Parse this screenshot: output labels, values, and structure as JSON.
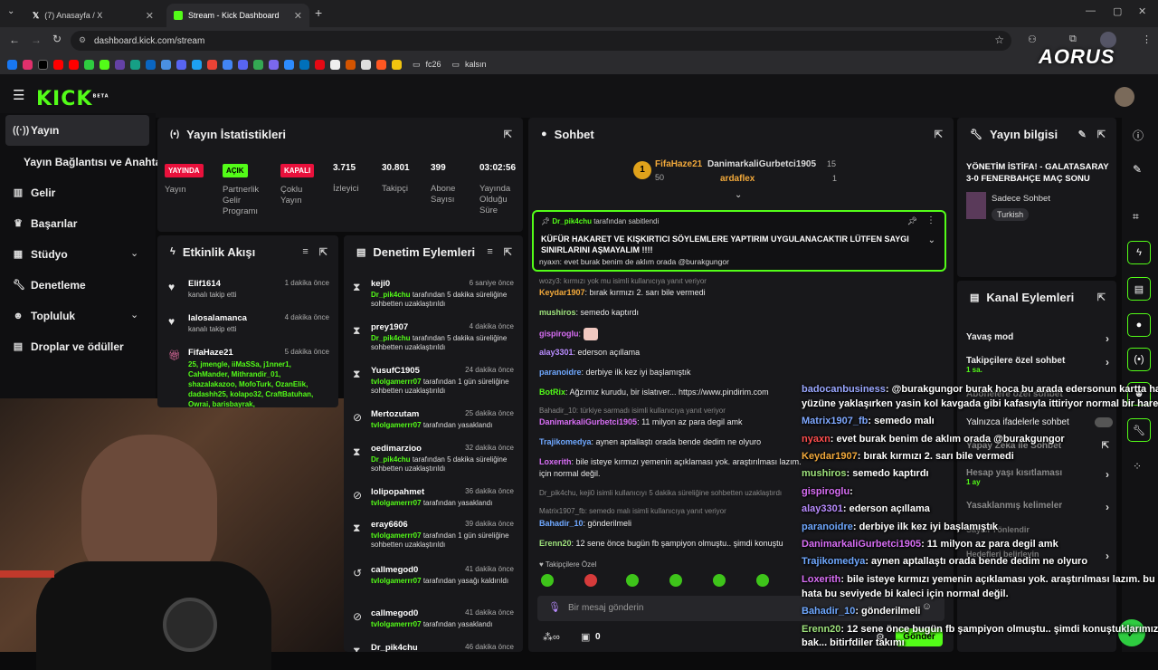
{
  "browser": {
    "tabs": [
      {
        "label": "(7) Anasayfa / X"
      },
      {
        "label": "Stream - Kick Dashboard"
      }
    ],
    "url": "dashboard.kick.com/stream",
    "bookmarks": [
      "fc26",
      "kalsın"
    ]
  },
  "app": {
    "logo": "KICK",
    "logo_sup": "BETA"
  },
  "sidebar": {
    "items": [
      {
        "label": "Yayın",
        "icon": "broadcast-icon"
      },
      {
        "label": "Yayın Bağlantısı ve Anahtarı",
        "icon": ""
      },
      {
        "label": "Gelir",
        "icon": "chart-icon"
      },
      {
        "label": "Başarılar",
        "icon": "trophy-icon"
      },
      {
        "label": "Stüdyo",
        "icon": "grid-icon"
      },
      {
        "label": "Denetleme",
        "icon": "wrench-icon"
      },
      {
        "label": "Topluluk",
        "icon": "people-icon"
      },
      {
        "label": "Droplar ve ödüller",
        "icon": "gift-icon"
      }
    ]
  },
  "stats": {
    "title": "Yayın İstatistikleri",
    "badges": [
      {
        "label": "YAYINDA",
        "sub": "Yayın"
      },
      {
        "label": "AÇIK",
        "sub": "Partnerlik Gelir Programı"
      },
      {
        "label": "KAPALI",
        "sub": "Çoklu Yayın"
      }
    ],
    "values": [
      {
        "value": "3.715",
        "label": "İzleyici"
      },
      {
        "value": "30.801",
        "label": "Takipçi"
      },
      {
        "value": "399",
        "label": "Abone Sayısı"
      },
      {
        "value": "03:02:56",
        "label": "Yayında Olduğu Süre"
      }
    ]
  },
  "activity": {
    "title": "Etkinlik Akışı",
    "items": [
      {
        "name": "Elif1614",
        "time": "1 dakika önce",
        "desc": "kanalı takip etti"
      },
      {
        "name": "lalosalamanca",
        "time": "4 dakika önce",
        "desc": "kanalı takip etti"
      },
      {
        "name": "FifaHaze21",
        "time": "5 dakika önce",
        "desc": "25, jmengle, iiMaSSa, j1nner1, CahMander, Mithrandir_01, shazalakazoo, MofoTurk, OzanElik, dadashh25, kolapo32, CraftBatuhan, Owrai, barisbayrak,"
      }
    ]
  },
  "moderation": {
    "title": "Denetim Eylemleri",
    "items": [
      {
        "name": "keji0",
        "time": "6 saniye önce",
        "mod": "Dr_pik4chu",
        "desc": "tarafından 5 dakika süreliğine sohbetten uzaklaştırıldı"
      },
      {
        "name": "prey1907",
        "time": "4 dakika önce",
        "mod": "Dr_pik4chu",
        "desc": "tarafından 5 dakika süreliğine sohbetten uzaklaştırıldı"
      },
      {
        "name": "YusufC1905",
        "time": "24 dakika önce",
        "mod": "tvlolgamerrr07",
        "desc": "tarafından 1 gün süreliğine sohbetten uzaklaştırıldı"
      },
      {
        "name": "Mertozutam",
        "time": "25 dakika önce",
        "mod": "tvlolgamerrr07",
        "desc": "tarafından yasaklandı"
      },
      {
        "name": "oedimarzioo",
        "time": "32 dakika önce",
        "mod": "Dr_pik4chu",
        "desc": "tarafından 5 dakika süreliğine sohbetten uzaklaştırıldı"
      },
      {
        "name": "lolipopahmet",
        "time": "36 dakika önce",
        "mod": "tvlolgamerrr07",
        "desc": "tarafından yasaklandı"
      },
      {
        "name": "eray6606",
        "time": "39 dakika önce",
        "mod": "tvlolgamerrr07",
        "desc": "tarafından 1 gün süreliğine sohbetten uzaklaştırıldı"
      },
      {
        "name": "callmegod0",
        "time": "41 dakika önce",
        "mod": "tvlolgamerrr07",
        "desc": "tarafından yasağı kaldırıldı"
      },
      {
        "name": "callmegod0",
        "time": "41 dakika önce",
        "mod": "tvlolgamerrr07",
        "desc": "tarafından yasaklandı"
      },
      {
        "name": "Dr_pik4chu",
        "time": "46 dakika önce",
        "mod": "",
        "desc": ""
      }
    ]
  },
  "chat": {
    "title": "Sohbet",
    "leaders": [
      {
        "name": "FifaHaze21",
        "value": "50"
      },
      {
        "name": "DanimarkaliGurbetci1905",
        "value": "15"
      },
      {
        "name": "ardaflex",
        "value": "1"
      }
    ],
    "pinned": {
      "by": "Dr_pik4chu",
      "label": "tarafından sabitlendi",
      "text": "KÜFÜR HAKARET VE KIŞKIRTICI SÖYLEMLERE YAPTIRIM UYGULANACAKTIR LÜTFEN SAYGI SINIRLARINI AŞMAYALIM !!!!"
    },
    "peek": "nyaxn: evet burak benim de aklım orada @burakgungor",
    "messages": [
      {
        "kind": "sys",
        "text": "wozy3: kırmızı yok mu isimli kullanıcıya yanıt veriyor"
      },
      {
        "user": "Keydar1907",
        "color": "#f2a93b",
        "text": ": bırak kırmızı 2. sarı bile vermedi"
      },
      {
        "user": "mushiros",
        "color": "#9ee27c",
        "text": ": semedo kaptırdı"
      },
      {
        "user": "gispiroglu",
        "color": "#d86ef5",
        "text": ":"
      },
      {
        "user": "alay3301",
        "color": "#b98cff",
        "text": ": ederson açıllama"
      },
      {
        "user": "paranoidre",
        "color": "#6fa8ff",
        "text": ": derbiye ilk kez iyi başlamıştık"
      },
      {
        "user": "BotRix",
        "color": "#53fc18",
        "text": ": Ağzımız kurudu, bir islatıver... https://www.pindirim.com"
      },
      {
        "kind": "sys",
        "text": "Bahadir_10: türkiye sarmadı isimli kullanıcıya yanıt veriyor"
      },
      {
        "user": "DanimarkaliGurbetci1905",
        "color": "#d86ef5",
        "text": ": 11 milyon az para degil amk"
      },
      {
        "user": "Trajikomedya",
        "color": "#6fa8ff",
        "text": ": aynen aptallaştı orada bende dedim ne olyuro"
      },
      {
        "user": "Loxerith",
        "color": "#d86ef5",
        "text": ": bile isteye kırmızı yemenin açıklaması yok. araştırılması lazım."
      },
      {
        "kind": "cont",
        "text": "için normal değil."
      },
      {
        "kind": "sys",
        "text": "Dr_pik4chu, keji0 isimli kullanıcıyı 5 dakika süreliğine sohbetten uzaklaştırdı"
      },
      {
        "kind": "sys",
        "text": "Matrix1907_fb: semedo malı isimli kullanıcıya yanıt veriyor"
      },
      {
        "user": "Bahadir_10",
        "color": "#6fa8ff",
        "text": ": gönderilmeli"
      },
      {
        "user": "Erenn20",
        "color": "#9ee27c",
        "text": ": 12 sene önce bugün fb şampiyon olmuştu.. şimdi konuştu"
      }
    ],
    "followers_only": "Takipçilere Özel",
    "input_placeholder": "Bir mesaj gönderin",
    "send_label": "Gönder",
    "count": "0"
  },
  "stream_info": {
    "title": "Yayın bilgisi",
    "stream_title": "YÖNETİM İSTİFA! - GALATASARAY 3-0 FENERBAHÇE MAÇ SONU",
    "category": "Sadece Sohbet",
    "tag": "Turkish"
  },
  "channel_actions": {
    "title": "Kanal Eylemleri",
    "items": [
      {
        "label": "Yavaş mod",
        "sub": ""
      },
      {
        "label": "Takipçilere özel sohbet",
        "sub": "1 sa."
      },
      {
        "label": "Abonelere özel sohbet",
        "sub": ""
      },
      {
        "label": "Yalnızca ifadelerle sohbet",
        "sub": ""
      },
      {
        "label": "Yapay Zeka ile Sohbet",
        "sub": ""
      },
      {
        "label": "Hesap yaşı kısıtlaması",
        "sub": "1 ay"
      },
      {
        "label": "Yasaklanmış kelimeler",
        "sub": ""
      },
      {
        "label": "Sayıcı Yönlendir",
        "sub": ""
      },
      {
        "label": "Hedefleri belirleyin",
        "sub": ""
      }
    ]
  },
  "overlay_chat": [
    {
      "user": "badocanbusiness",
      "color": "#9aa7ff",
      "text": ": @burakgungor burak hoca bu arada edersonun kartta hakemin"
    },
    {
      "user": "",
      "color": "#fff",
      "text": "yüzüne yaklaşırken yasin kol kavgada gibi kafasıyla ittiriyor normal bir hareket mi"
    },
    {
      "user": "Matrix1907_fb",
      "color": "#7fa8ff",
      "text": ": semedo malı"
    },
    {
      "user": "nyaxn",
      "color": "#ff4e4e",
      "text": ": evet burak benim de aklım orada @burakgungor"
    },
    {
      "user": "Keydar1907",
      "color": "#f2a93b",
      "text": ": bırak kırmızı 2. sarı bile vermedi"
    },
    {
      "user": "mushiros",
      "color": "#9ee27c",
      "text": ": semedo kaptırdı"
    },
    {
      "user": "gispiroglu",
      "color": "#d86ef5",
      "text": ":"
    },
    {
      "user": "alay3301",
      "color": "#b98cff",
      "text": ": ederson açıllama"
    },
    {
      "user": "paranoidre",
      "color": "#6fa8ff",
      "text": ": derbiye ilk kez iyi başlamıştık"
    },
    {
      "user": "DanimarkaliGurbetci1905",
      "color": "#d86ef5",
      "text": ": 11 milyon az para degil amk"
    },
    {
      "user": "Trajikomedya",
      "color": "#6fa8ff",
      "text": ": aynen aptallaştı orada bende dedim ne olyuro"
    },
    {
      "user": "Loxerith",
      "color": "#d86ef5",
      "text": ": bile isteye kırmızı yemenin açıklaması yok. araştırılması lazım. bu kadar"
    },
    {
      "user": "",
      "color": "#fff",
      "text": "hata bu seviyede bi kaleci için normal değil."
    },
    {
      "user": "Bahadir_10",
      "color": "#6fa8ff",
      "text": ": gönderilmeli"
    },
    {
      "user": "Erenn20",
      "color": "#9ee27c",
      "text": ": 12 sene önce bugün fb şampiyon olmuştu.. şimdi konuştuklarımıza"
    },
    {
      "user": "",
      "color": "#fff",
      "text": "bak... bitirfdiler takımı"
    }
  ],
  "watermark": "AORUS",
  "colors": {
    "accent": "#53fc18",
    "live": "#e9113c",
    "panel": "#18181b"
  }
}
